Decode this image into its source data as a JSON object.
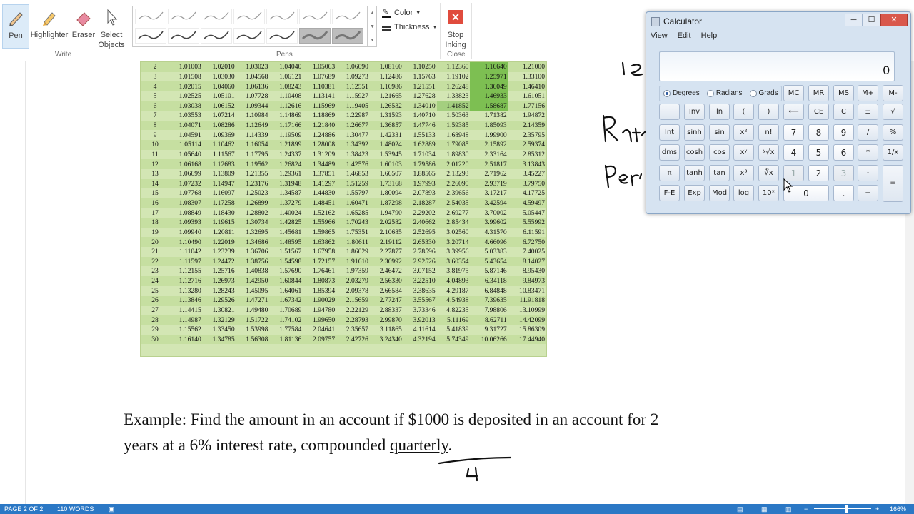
{
  "ribbon": {
    "tools": [
      {
        "label": "Pen",
        "icon": "pen-icon"
      },
      {
        "label": "Highlighter",
        "icon": "highlighter-icon"
      },
      {
        "label": "Eraser",
        "icon": "eraser-icon"
      },
      {
        "label": "Select",
        "label2": "Objects",
        "icon": "select-objects-icon"
      }
    ],
    "write_group": "Write",
    "pens_group": "Pens",
    "color_label": "Color",
    "thickness_label": "Thickness",
    "stop_label": "Stop",
    "stop_label2": "Inking",
    "close_group": "Close"
  },
  "table": {
    "rows": [
      [
        "2",
        "1.01003",
        "1.02010",
        "1.03023",
        "1.04040",
        "1.05063",
        "1.06090",
        "1.08160",
        "1.10250",
        "1.12360",
        "1.16640",
        "1.21000"
      ],
      [
        "3",
        "1.01508",
        "1.03030",
        "1.04568",
        "1.06121",
        "1.07689",
        "1.09273",
        "1.12486",
        "1.15763",
        "1.19102",
        "1.25971",
        "1.33100"
      ],
      [
        "4",
        "1.02015",
        "1.04060",
        "1.06136",
        "1.08243",
        "1.10381",
        "1.12551",
        "1.16986",
        "1.21551",
        "1.26248",
        "1.36049",
        "1.46410"
      ],
      [
        "5",
        "1.02525",
        "1.05101",
        "1.07728",
        "1.10408",
        "1.13141",
        "1.15927",
        "1.21665",
        "1.27628",
        "1.33823",
        "1.46933",
        "1.61051"
      ],
      [
        "6",
        "1.03038",
        "1.06152",
        "1.09344",
        "1.12616",
        "1.15969",
        "1.19405",
        "1.26532",
        "1.34010",
        "1.41852",
        "1.58687",
        "1.77156"
      ],
      [
        "7",
        "1.03553",
        "1.07214",
        "1.10984",
        "1.14869",
        "1.18869",
        "1.22987",
        "1.31593",
        "1.40710",
        "1.50363",
        "1.71382",
        "1.94872"
      ],
      [
        "8",
        "1.04071",
        "1.08286",
        "1.12649",
        "1.17166",
        "1.21840",
        "1.26677",
        "1.36857",
        "1.47746",
        "1.59385",
        "1.85093",
        "2.14359"
      ],
      [
        "9",
        "1.04591",
        "1.09369",
        "1.14339",
        "1.19509",
        "1.24886",
        "1.30477",
        "1.42331",
        "1.55133",
        "1.68948",
        "1.99900",
        "2.35795"
      ],
      [
        "10",
        "1.05114",
        "1.10462",
        "1.16054",
        "1.21899",
        "1.28008",
        "1.34392",
        "1.48024",
        "1.62889",
        "1.79085",
        "2.15892",
        "2.59374"
      ],
      [
        "11",
        "1.05640",
        "1.11567",
        "1.17795",
        "1.24337",
        "1.31209",
        "1.38423",
        "1.53945",
        "1.71034",
        "1.89830",
        "2.33164",
        "2.85312"
      ],
      [
        "12",
        "1.06168",
        "1.12683",
        "1.19562",
        "1.26824",
        "1.34489",
        "1.42576",
        "1.60103",
        "1.79586",
        "2.01220",
        "2.51817",
        "3.13843"
      ],
      [
        "13",
        "1.06699",
        "1.13809",
        "1.21355",
        "1.29361",
        "1.37851",
        "1.46853",
        "1.66507",
        "1.88565",
        "2.13293",
        "2.71962",
        "3.45227"
      ],
      [
        "14",
        "1.07232",
        "1.14947",
        "1.23176",
        "1.31948",
        "1.41297",
        "1.51259",
        "1.73168",
        "1.97993",
        "2.26090",
        "2.93719",
        "3.79750"
      ],
      [
        "15",
        "1.07768",
        "1.16097",
        "1.25023",
        "1.34587",
        "1.44830",
        "1.55797",
        "1.80094",
        "2.07893",
        "2.39656",
        "3.17217",
        "4.17725"
      ],
      [
        "16",
        "1.08307",
        "1.17258",
        "1.26899",
        "1.37279",
        "1.48451",
        "1.60471",
        "1.87298",
        "2.18287",
        "2.54035",
        "3.42594",
        "4.59497"
      ],
      [
        "17",
        "1.08849",
        "1.18430",
        "1.28802",
        "1.40024",
        "1.52162",
        "1.65285",
        "1.94790",
        "2.29202",
        "2.69277",
        "3.70002",
        "5.05447"
      ],
      [
        "18",
        "1.09393",
        "1.19615",
        "1.30734",
        "1.42825",
        "1.55966",
        "1.70243",
        "2.02582",
        "2.40662",
        "2.85434",
        "3.99602",
        "5.55992"
      ],
      [
        "19",
        "1.09940",
        "1.20811",
        "1.32695",
        "1.45681",
        "1.59865",
        "1.75351",
        "2.10685",
        "2.52695",
        "3.02560",
        "4.31570",
        "6.11591"
      ],
      [
        "20",
        "1.10490",
        "1.22019",
        "1.34686",
        "1.48595",
        "1.63862",
        "1.80611",
        "2.19112",
        "2.65330",
        "3.20714",
        "4.66096",
        "6.72750"
      ],
      [
        "21",
        "1.11042",
        "1.23239",
        "1.36706",
        "1.51567",
        "1.67958",
        "1.86029",
        "2.27877",
        "2.78596",
        "3.39956",
        "5.03383",
        "7.40025"
      ],
      [
        "22",
        "1.11597",
        "1.24472",
        "1.38756",
        "1.54598",
        "1.72157",
        "1.91610",
        "2.36992",
        "2.92526",
        "3.60354",
        "5.43654",
        "8.14027"
      ],
      [
        "23",
        "1.12155",
        "1.25716",
        "1.40838",
        "1.57690",
        "1.76461",
        "1.97359",
        "2.46472",
        "3.07152",
        "3.81975",
        "5.87146",
        "8.95430"
      ],
      [
        "24",
        "1.12716",
        "1.26973",
        "1.42950",
        "1.60844",
        "1.80873",
        "2.03279",
        "2.56330",
        "3.22510",
        "4.04893",
        "6.34118",
        "9.84973"
      ],
      [
        "25",
        "1.13280",
        "1.28243",
        "1.45095",
        "1.64061",
        "1.85394",
        "2.09378",
        "2.66584",
        "3.38635",
        "4.29187",
        "6.84848",
        "10.83471"
      ],
      [
        "26",
        "1.13846",
        "1.29526",
        "1.47271",
        "1.67342",
        "1.90029",
        "2.15659",
        "2.77247",
        "3.55567",
        "4.54938",
        "7.39635",
        "11.91818"
      ],
      [
        "27",
        "1.14415",
        "1.30821",
        "1.49480",
        "1.70689",
        "1.94780",
        "2.22129",
        "2.88337",
        "3.73346",
        "4.82235",
        "7.98806",
        "13.10999"
      ],
      [
        "28",
        "1.14987",
        "1.32129",
        "1.51722",
        "1.74102",
        "1.99650",
        "2.28793",
        "2.99870",
        "3.92013",
        "5.11169",
        "8.62711",
        "14.42099"
      ],
      [
        "29",
        "1.15562",
        "1.33450",
        "1.53998",
        "1.77584",
        "2.04641",
        "2.35657",
        "3.11865",
        "4.11614",
        "5.41839",
        "9.31727",
        "15.86309"
      ],
      [
        "30",
        "1.16140",
        "1.34785",
        "1.56308",
        "1.81136",
        "2.09757",
        "2.42726",
        "3.24340",
        "4.32194",
        "5.74349",
        "10.06266",
        "17.44940"
      ]
    ]
  },
  "example": {
    "line1": "Example:  Find the amount in an account if $1000 is deposited in an account for 2",
    "line2_pre": "years at a 6% interest rate, compounded ",
    "line2_word": "quarterly",
    "line2_post": "."
  },
  "calculator": {
    "title": "Calculator",
    "menu": [
      "View",
      "Edit",
      "Help"
    ],
    "display": "0",
    "modes": [
      "Degrees",
      "Radians",
      "Grads"
    ],
    "selected_mode": "Degrees",
    "keys": {
      "mc": "MC",
      "mr": "MR",
      "ms": "MS",
      "mplus": "M+",
      "mminus": "M-",
      "inv": "Inv",
      "ln": "ln",
      "lparen": "(",
      "rparen": ")",
      "back": "⟵",
      "ce": "CE",
      "c": "C",
      "pm": "±",
      "sqrt": "√",
      "int": "Int",
      "sinh": "sinh",
      "sin": "sin",
      "x2": "x²",
      "fact": "n!",
      "k7": "7",
      "k8": "8",
      "k9": "9",
      "div": "/",
      "pct": "%",
      "dms": "dms",
      "cosh": "cosh",
      "cos": "cos",
      "xy": "xʸ",
      "yroot": "ʸ√x",
      "k4": "4",
      "k5": "5",
      "k6": "6",
      "mul": "*",
      "recip": "1/x",
      "pi": "π",
      "tanh": "tanh",
      "tan": "tan",
      "x3": "x³",
      "root3": "∛x",
      "k1": "1",
      "k2": "2",
      "k3": "3",
      "sub": "-",
      "eq": "=",
      "fe": "F-E",
      "exp": "Exp",
      "mod": "Mod",
      "log": "log",
      "ten": "10ˣ",
      "k0": "0",
      "dot": ".",
      "add": "+"
    }
  },
  "status": {
    "page": "PAGE 2 OF 2",
    "words": "110 WORDS",
    "zoom": "166%"
  }
}
